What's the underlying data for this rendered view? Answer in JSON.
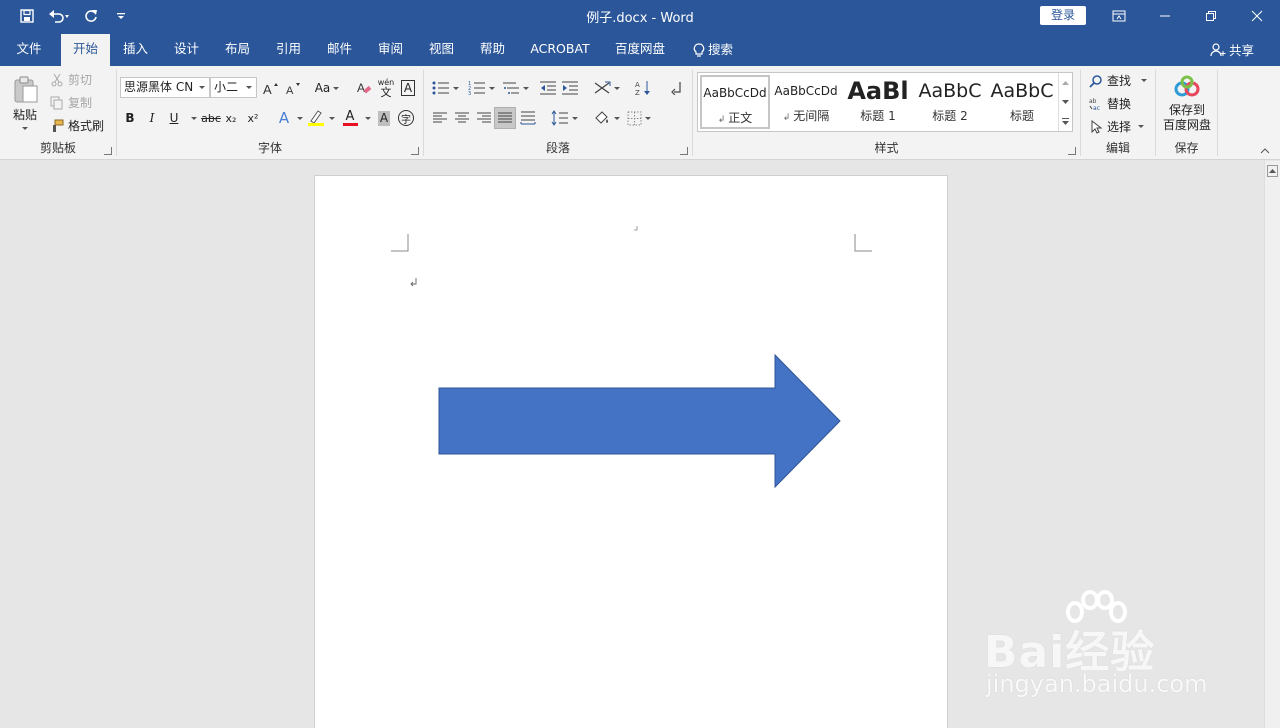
{
  "titlebar": {
    "doc_title": "例子.docx  -  Word",
    "login_label": "登录",
    "qat_more": "="
  },
  "tabs": [
    {
      "label": "文件"
    },
    {
      "label": "开始"
    },
    {
      "label": "插入"
    },
    {
      "label": "设计"
    },
    {
      "label": "布局"
    },
    {
      "label": "引用"
    },
    {
      "label": "邮件"
    },
    {
      "label": "审阅"
    },
    {
      "label": "视图"
    },
    {
      "label": "帮助"
    },
    {
      "label": "ACROBAT"
    },
    {
      "label": "百度网盘"
    }
  ],
  "tell_me": "搜索",
  "share": "共享",
  "clipboard": {
    "paste": "粘贴",
    "cut": "剪切",
    "copy": "复制",
    "format_painter": "格式刷",
    "label": "剪贴板"
  },
  "font": {
    "family": "思源黑体 CN",
    "size": "小二",
    "case_btn": "Aa",
    "phonetic_glyph": "wén",
    "char_border": "A",
    "bold": "B",
    "italic": "I",
    "underline": "U",
    "strike": "abc",
    "subscript": "x₂",
    "superscript": "x²",
    "effects": "A",
    "font_color": "A",
    "shading": "A",
    "enclose": "字",
    "label": "字体",
    "highlight_color": "#ffff00",
    "font_color_value": "#e81123"
  },
  "paragraph": {
    "label": "段落"
  },
  "styles": {
    "items": [
      {
        "preview": "AaBbCcDd",
        "name": "正文"
      },
      {
        "preview": "AaBbCcDd",
        "name": "无间隔"
      },
      {
        "preview": "AaBl",
        "name": "标题 1"
      },
      {
        "preview": "AaBbC",
        "name": "标题 2"
      },
      {
        "preview": "AaBbC",
        "name": "标题"
      }
    ],
    "label": "样式"
  },
  "editing": {
    "find": "查找",
    "replace": "替换",
    "select": "选择",
    "label": "编辑"
  },
  "save": {
    "button": "保存到\n百度网盘",
    "label": "保存"
  },
  "document": {
    "shape_color": "#4472c4",
    "shape_border": "#2f5597"
  },
  "watermark": {
    "brand": "Bai经验",
    "url": "jingyan.baidu.com"
  }
}
